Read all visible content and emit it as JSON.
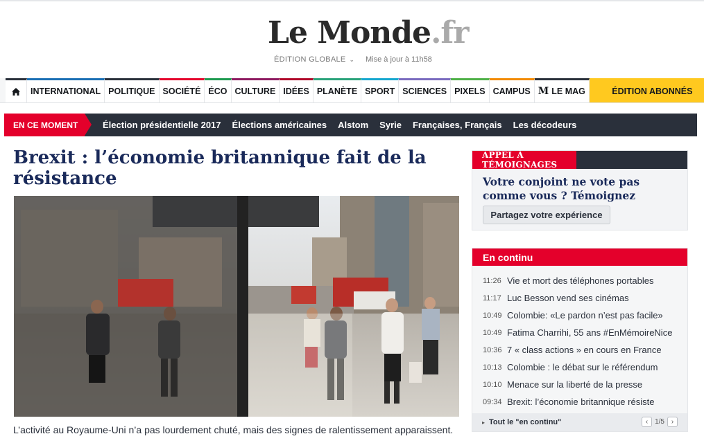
{
  "header": {
    "logo_main": "Le Monde",
    "logo_suffix": ".fr",
    "edition": "ÉDITION GLOBALE",
    "edition_icon": "chevron-down-icon",
    "updated": "Mise à jour à 11h58"
  },
  "nav": {
    "home_icon": "home-icon",
    "items": [
      {
        "label": "INTERNATIONAL",
        "color": "#1a6fb4"
      },
      {
        "label": "POLITIQUE",
        "color": "#2a303b"
      },
      {
        "label": "SOCIÉTÉ",
        "color": "#e4002b"
      },
      {
        "label": "ÉCO",
        "color": "#1e9a50"
      },
      {
        "label": "CULTURE",
        "color": "#8e1a60"
      },
      {
        "label": "IDÉES",
        "color": "#b00a2a"
      },
      {
        "label": "PLANÈTE",
        "color": "#2aa37a"
      },
      {
        "label": "SPORT",
        "color": "#16a7cf"
      },
      {
        "label": "SCIENCES",
        "color": "#7a6bbf"
      },
      {
        "label": "PIXELS",
        "color": "#4fb047"
      },
      {
        "label": "CAMPUS",
        "color": "#f28a00"
      },
      {
        "label": "LE MAG",
        "color": "#2a303b"
      }
    ],
    "abonnes": "ÉDITION ABONNÉS",
    "abonnes_color": "#ffc91f"
  },
  "moment": {
    "label": "EN CE MOMENT",
    "links": [
      "Élection présidentielle 2017",
      "Élections américaines",
      "Alstom",
      "Syrie",
      "Françaises, Français",
      "Les décodeurs"
    ]
  },
  "article": {
    "headline": "Brexit : l’économie britannique fait de la résistance",
    "caption": "L’activité au Royaume-Uni n’a pas lourdement chuté, mais des signes de ralentissement apparaissent."
  },
  "temoignages": {
    "tag": "APPEL À TÉMOIGNAGES",
    "title": "Votre conjoint ne vote pas comme vous ? Témoignez",
    "button": "Partagez votre expérience"
  },
  "continu": {
    "title": "En continu",
    "items": [
      {
        "time": "11:26",
        "text": "Vie et mort des téléphones portables"
      },
      {
        "time": "11:17",
        "text": "Luc Besson vend ses cinémas"
      },
      {
        "time": "10:49",
        "text": "Colombie: «Le pardon n’est pas facile»"
      },
      {
        "time": "10:49",
        "text": "Fatima Charrihi, 55 ans #EnMémoireNice"
      },
      {
        "time": "10:36",
        "text": "7 « class actions » en cours en France"
      },
      {
        "time": "10:13",
        "text": "Colombie : le débat sur le référendum"
      },
      {
        "time": "10:10",
        "text": "Menace sur la liberté de la presse"
      },
      {
        "time": "09:34",
        "text": "Brexit: l’économie britannique résiste"
      }
    ],
    "footer_link": "Tout le \"en continu\"",
    "pager": "1/5",
    "prev_icon": "chevron-left-icon",
    "next_icon": "chevron-right-icon"
  },
  "colors": {
    "accent_red": "#e4002b",
    "dark": "#2a303b",
    "headline_blue": "#1a2a5a"
  }
}
